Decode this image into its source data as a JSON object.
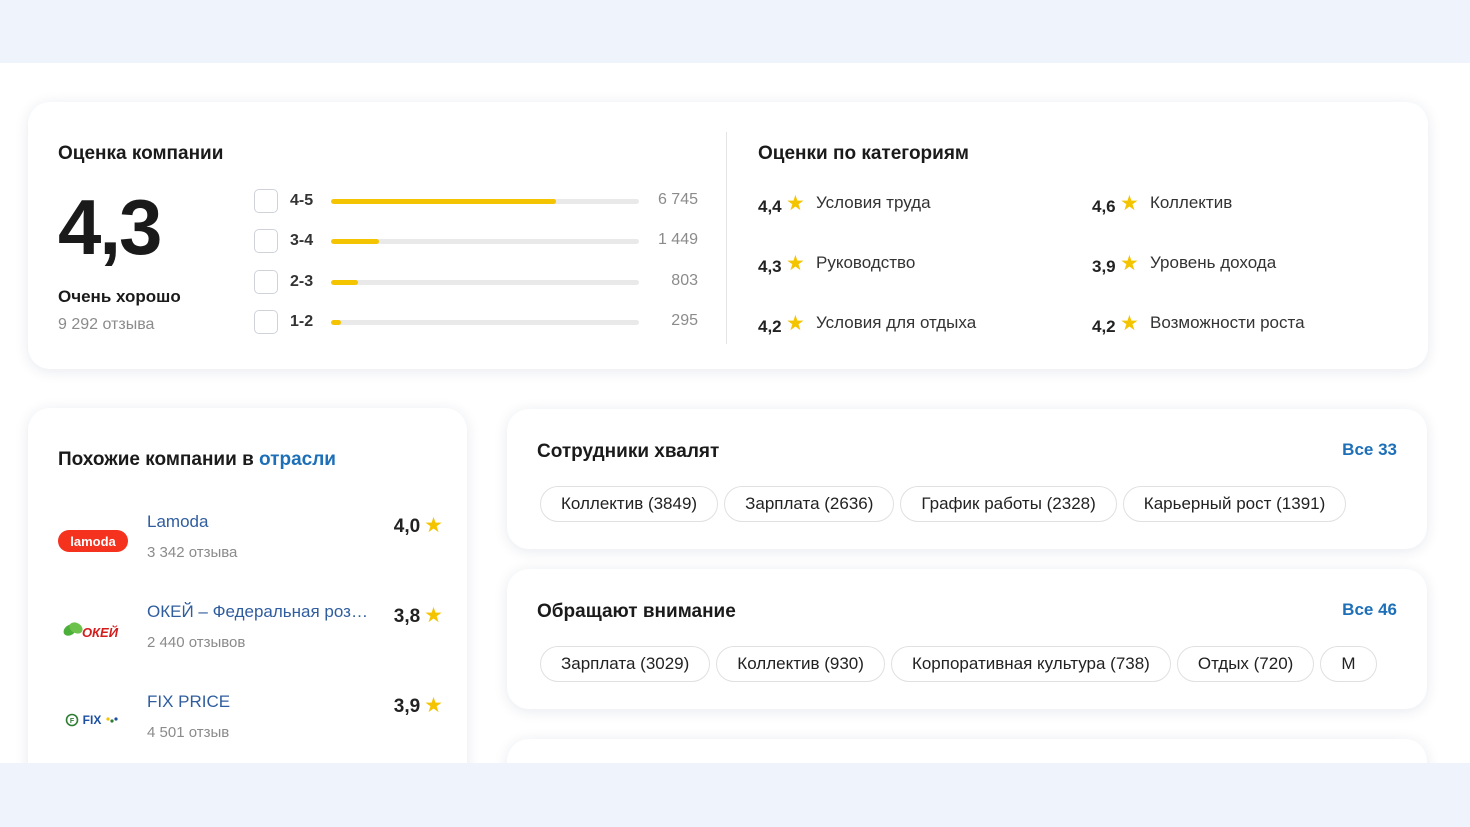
{
  "rating": {
    "title": "Оценка компании",
    "score": "4,3",
    "verdict": "Очень хорошо",
    "reviews": "9 292 отзыва",
    "distribution": [
      {
        "label": "4-5",
        "count": "6 745",
        "fraction": 0.729
      },
      {
        "label": "3-4",
        "count": "1 449",
        "fraction": 0.157
      },
      {
        "label": "2-3",
        "count": "803",
        "fraction": 0.087
      },
      {
        "label": "1-2",
        "count": "295",
        "fraction": 0.032
      }
    ]
  },
  "categories": {
    "title": "Оценки по категориям",
    "items": [
      {
        "score": "4,4",
        "label": "Условия труда"
      },
      {
        "score": "4,6",
        "label": "Коллектив"
      },
      {
        "score": "4,3",
        "label": "Руководство"
      },
      {
        "score": "3,9",
        "label": "Уровень дохода"
      },
      {
        "score": "4,2",
        "label": "Условия для отдыха"
      },
      {
        "score": "4,2",
        "label": "Возможности роста"
      }
    ]
  },
  "similar": {
    "title": "Похожие компании в",
    "title_link": "отрасли",
    "companies": [
      {
        "name": "Lamoda",
        "reviews": "3 342 отзыва",
        "score": "4,0",
        "logo_text": "lamoda"
      },
      {
        "name": "ОКЕЙ – Федеральная розничная сеть",
        "reviews": "2 440 отзывов",
        "score": "3,8",
        "logo_text": "ОКЕЙ"
      },
      {
        "name": "FIX PRICE",
        "reviews": "4 501 отзыв",
        "score": "3,9",
        "logo_text": "FIX"
      }
    ]
  },
  "praise": {
    "title": "Сотрудники хвалят",
    "all_label": "Все 33",
    "tags": [
      "Коллектив (3849)",
      "Зарплата (2636)",
      "График работы (2328)",
      "Карьерный рост (1391)"
    ]
  },
  "attention": {
    "title": "Обращают внимание",
    "all_label": "Все 46",
    "tags": [
      "Зарплата (3029)",
      "Коллектив (930)",
      "Корпоративная культура (738)",
      "Отдых (720)",
      "М"
    ]
  },
  "colors": {
    "accent_yellow": "#f5c400",
    "link_blue": "#1d6fb8",
    "lamoda_red": "#f4321e",
    "okey_red": "#d31c1c"
  },
  "icons": {
    "star": "star-icon",
    "checkbox": "checkbox-icon"
  }
}
